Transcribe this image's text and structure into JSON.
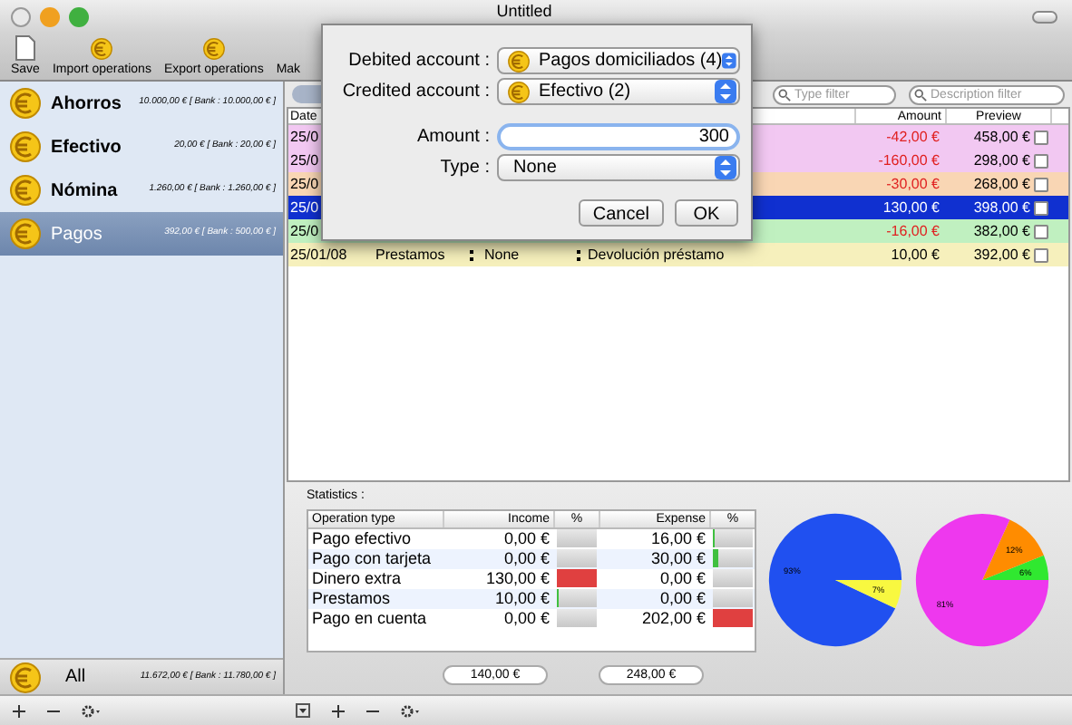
{
  "window": {
    "title": "Untitled"
  },
  "toolbar": [
    {
      "label": "Save",
      "kind": "doc"
    },
    {
      "label": "Import operations",
      "kind": "coin"
    },
    {
      "label": "Export operations",
      "kind": "coin"
    },
    {
      "label": "Mak",
      "kind": "none"
    }
  ],
  "accounts": [
    {
      "name": "Ahorros",
      "balance": "10.000,00 € [ Bank : 10.000,00 € ]",
      "selected": false
    },
    {
      "name": "Efectivo",
      "balance": "20,00 € [ Bank : 20,00 € ]",
      "selected": false
    },
    {
      "name": "Nómina",
      "balance": "1.260,00 € [ Bank : 1.260,00 € ]",
      "selected": false
    },
    {
      "name": "Pagos",
      "balance": "392,00 € [ Bank : 500,00 € ]",
      "selected": true
    }
  ],
  "total": {
    "name": "All",
    "balance": "11.672,00 € [ Bank : 11.780,00 € ]"
  },
  "filters": [
    {
      "placeholder": "Type filter"
    },
    {
      "placeholder": "Description filter"
    }
  ],
  "table": {
    "columns": [
      "Date",
      "Amount",
      "Preview"
    ],
    "rows": [
      {
        "date": "25/0",
        "amount": "-42,00 €",
        "preview": "458,00 €",
        "color": "#f2c8f2",
        "negative": true,
        "selected": false,
        "checked": false
      },
      {
        "date": "25/0",
        "amount": "-160,00 €",
        "preview": "298,00 €",
        "color": "#f2c8f2",
        "negative": true,
        "selected": false,
        "checked": false
      },
      {
        "date": "25/0",
        "amount": "-30,00 €",
        "preview": "268,00 €",
        "color": "#f9d6b4",
        "negative": true,
        "selected": false,
        "checked": false
      },
      {
        "date": "25/0",
        "amount": "130,00 €",
        "preview": "398,00 €",
        "negative": false,
        "selected": true,
        "checked": false
      },
      {
        "date": "25/0",
        "amount": "-16,00 €",
        "preview": "382,00 €",
        "color": "#c0f0c0",
        "negative": true,
        "selected": false,
        "checked": false
      },
      {
        "date": "25/01/08",
        "category": "Prestamos",
        "type": "None",
        "description": "Devolución préstamo",
        "amount": "10,00 €",
        "preview": "392,00 €",
        "color": "#f6f0bc",
        "negative": false,
        "selected": false,
        "checked": false
      }
    ]
  },
  "statistics": {
    "label": "Statistics :",
    "columns": [
      "Operation type",
      "Income",
      "%",
      "Expense",
      "%"
    ],
    "rows": [
      {
        "name": "Pago efectivo",
        "income": "0,00 €",
        "income_bar": {
          "level": 0
        },
        "expense": "16,00 €",
        "expense_bar": {
          "level": 0.08
        }
      },
      {
        "name": "Pago con tarjeta",
        "income": "0,00 €",
        "income_bar": {
          "level": 0
        },
        "expense": "30,00 €",
        "expense_bar": {
          "level": 0.15
        }
      },
      {
        "name": "Dinero extra",
        "income": "130,00 €",
        "income_bar": {
          "level": 1
        },
        "expense": "0,00 €",
        "expense_bar": {
          "level": 0
        }
      },
      {
        "name": "Prestamos",
        "income": "10,00 €",
        "income_bar": {
          "level": 0.08
        },
        "expense": "0,00 €",
        "expense_bar": {
          "level": 0
        }
      },
      {
        "name": "Pago en cuenta",
        "income": "0,00 €",
        "income_bar": {
          "level": 0
        },
        "expense": "202,00 €",
        "expense_bar": {
          "level": 1
        }
      }
    ],
    "totals": [
      "140,00 €",
      "248,00 €"
    ],
    "charts": [
      {
        "chart_data": {
          "type": "pie",
          "values": [
            93,
            7
          ],
          "value_labels": [
            "93%",
            "7%"
          ],
          "colors": [
            "#2050f0",
            "#f8f840"
          ]
        }
      },
      {
        "chart_data": {
          "type": "pie",
          "values": [
            6,
            12,
            81
          ],
          "value_labels": [
            "6%",
            "12%",
            "81%"
          ],
          "colors": [
            "#30e830",
            "#ff8c00",
            "#ee38ee"
          ]
        }
      }
    ]
  },
  "dialog": {
    "debited_label": "Debited account :",
    "debited_value": "Pagos domiciliados (4)",
    "credited_label": "Credited account :",
    "credited_value": "Efectivo (2)",
    "amount_label": "Amount :",
    "amount_value": "300",
    "type_label": "Type :",
    "type_value": "None",
    "buttons": [
      "Cancel",
      "OK"
    ]
  }
}
